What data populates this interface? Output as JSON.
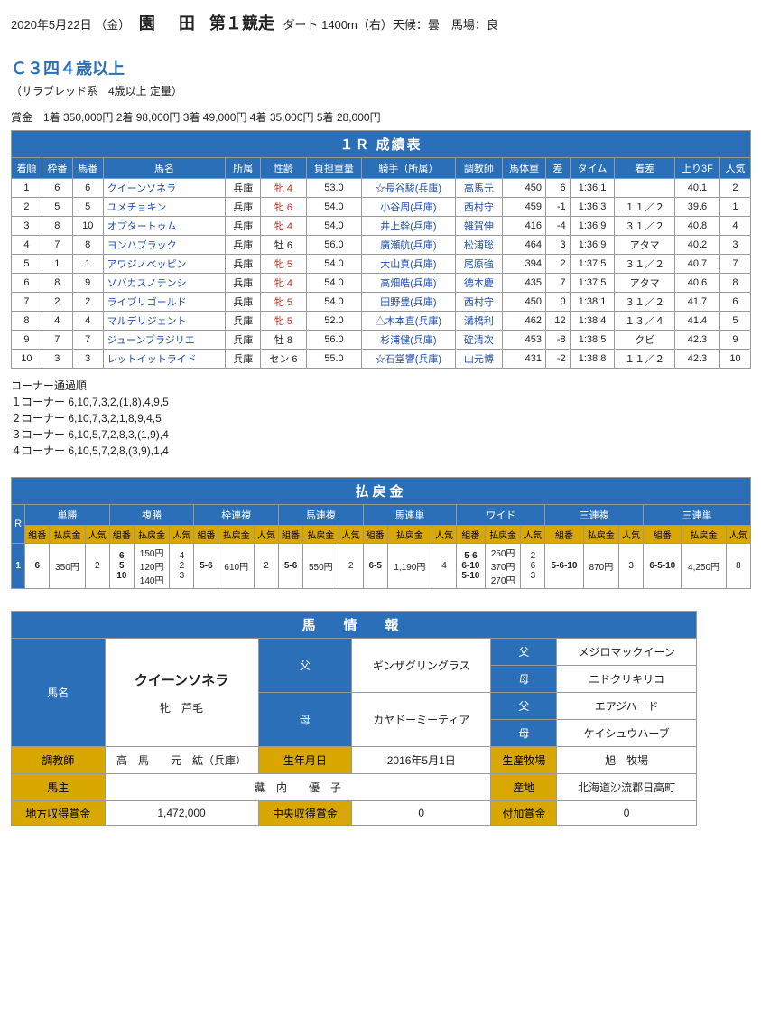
{
  "header": {
    "date": "2020年5月22日 （金）",
    "venue": "園　田",
    "race_no": "第１競走",
    "cond": "ダート 1400m（右）天候：曇　馬場：良"
  },
  "race": {
    "title": "Ｃ３四４歳以上",
    "sub": "（サラブレッド系　4歳以上 定量）",
    "prize": "賞金　1着 350,000円  2着 98,000円  3着 49,000円  4着 35,000円  5着 28,000円"
  },
  "results": {
    "title": "１Ｒ 成績表",
    "cols": [
      "着順",
      "枠番",
      "馬番",
      "馬名",
      "所属",
      "性齢",
      "負担重量",
      "騎手（所属）",
      "調教師",
      "馬体重",
      "差",
      "タイム",
      "着差",
      "上り3F",
      "人気"
    ],
    "rows": [
      {
        "p": "1",
        "w": "6",
        "n": "6",
        "horse": "クイーンソネラ",
        "aff": "兵庫",
        "sa": "牝 4",
        "fem": true,
        "wt": "53.0",
        "jk": "☆長谷駿(兵庫)",
        "tr": "高馬元",
        "bw": "450",
        "d": "6",
        "time": "1:36:1",
        "mg": "",
        "f3": "40.1",
        "pop": "2"
      },
      {
        "p": "2",
        "w": "5",
        "n": "5",
        "horse": "ユメチョキン",
        "aff": "兵庫",
        "sa": "牝 6",
        "fem": true,
        "wt": "54.0",
        "jk": "小谷周(兵庫)",
        "tr": "西村守",
        "bw": "459",
        "d": "-1",
        "time": "1:36:3",
        "mg": "１１／２",
        "f3": "39.6",
        "pop": "1"
      },
      {
        "p": "3",
        "w": "8",
        "n": "10",
        "horse": "オプタートゥム",
        "aff": "兵庫",
        "sa": "牝 4",
        "fem": true,
        "wt": "54.0",
        "jk": "井上幹(兵庫)",
        "tr": "雑賀伸",
        "bw": "416",
        "d": "-4",
        "time": "1:36:9",
        "mg": "３１／２",
        "f3": "40.8",
        "pop": "4"
      },
      {
        "p": "4",
        "w": "7",
        "n": "8",
        "horse": "ヨンハブラック",
        "aff": "兵庫",
        "sa": "牡 6",
        "fem": false,
        "wt": "56.0",
        "jk": "廣瀬航(兵庫)",
        "tr": "松浦聡",
        "bw": "464",
        "d": "3",
        "time": "1:36:9",
        "mg": "アタマ",
        "f3": "40.2",
        "pop": "3"
      },
      {
        "p": "5",
        "w": "1",
        "n": "1",
        "horse": "アワジノべッピン",
        "aff": "兵庫",
        "sa": "牝 5",
        "fem": true,
        "wt": "54.0",
        "jk": "大山真(兵庫)",
        "tr": "尾原強",
        "bw": "394",
        "d": "2",
        "time": "1:37:5",
        "mg": "３１／２",
        "f3": "40.7",
        "pop": "7"
      },
      {
        "p": "6",
        "w": "8",
        "n": "9",
        "horse": "ソバカスノテンシ",
        "aff": "兵庫",
        "sa": "牝 4",
        "fem": true,
        "wt": "54.0",
        "jk": "高畑皓(兵庫)",
        "tr": "德本慶",
        "bw": "435",
        "d": "7",
        "time": "1:37:5",
        "mg": "アタマ",
        "f3": "40.6",
        "pop": "8"
      },
      {
        "p": "7",
        "w": "2",
        "n": "2",
        "horse": "ライブリゴールド",
        "aff": "兵庫",
        "sa": "牝 5",
        "fem": true,
        "wt": "54.0",
        "jk": "田野豊(兵庫)",
        "tr": "西村守",
        "bw": "450",
        "d": "0",
        "time": "1:38:1",
        "mg": "３１／２",
        "f3": "41.7",
        "pop": "6"
      },
      {
        "p": "8",
        "w": "4",
        "n": "4",
        "horse": "マルデリジェント",
        "aff": "兵庫",
        "sa": "牝 5",
        "fem": true,
        "wt": "52.0",
        "jk": "△木本直(兵庫)",
        "tr": "溝橋利",
        "bw": "462",
        "d": "12",
        "time": "1:38:4",
        "mg": "１３／４",
        "f3": "41.4",
        "pop": "5"
      },
      {
        "p": "9",
        "w": "7",
        "n": "7",
        "horse": "ジューンブラジリエ",
        "aff": "兵庫",
        "sa": "牡 8",
        "fem": false,
        "wt": "56.0",
        "jk": "杉浦健(兵庫)",
        "tr": "碇清次",
        "bw": "453",
        "d": "-8",
        "time": "1:38:5",
        "mg": "クビ",
        "f3": "42.3",
        "pop": "9"
      },
      {
        "p": "10",
        "w": "3",
        "n": "3",
        "horse": "レットイットライド",
        "aff": "兵庫",
        "sa": "セン 6",
        "fem": false,
        "wt": "55.0",
        "jk": "☆石堂響(兵庫)",
        "tr": "山元博",
        "bw": "431",
        "d": "-2",
        "time": "1:38:8",
        "mg": "１１／２",
        "f3": "42.3",
        "pop": "10"
      }
    ]
  },
  "corners": {
    "h": "コーナー通過順",
    "l1": "１コーナー 6,10,7,3,2,(1,8),4,9,5",
    "l2": "２コーナー 6,10,7,3,2,1,8,9,4,5",
    "l3": "３コーナー 6,10,5,7,2,8,3,(1,9),4",
    "l4": "４コーナー 6,10,5,7,2,8,(3,9),1,4"
  },
  "payout": {
    "title": "払戻金",
    "r_label": "R",
    "groups": [
      "単勝",
      "複勝",
      "枠連複",
      "馬連複",
      "馬連単",
      "ワイド",
      "三連複",
      "三連単"
    ],
    "sub": [
      "組番",
      "払戻金",
      "人気"
    ],
    "race": "1",
    "tansho": {
      "n": "6",
      "pay": "350円",
      "pop": "2"
    },
    "fukusho": [
      {
        "n": "6",
        "pay": "150円",
        "pop": "4"
      },
      {
        "n": "5",
        "pay": "120円",
        "pop": "2"
      },
      {
        "n": "10",
        "pay": "140円",
        "pop": "3"
      }
    ],
    "wakuren": {
      "n": "5-6",
      "pay": "610円",
      "pop": "2"
    },
    "umaren": {
      "n": "5-6",
      "pay": "550円",
      "pop": "2"
    },
    "umatan": {
      "n": "6-5",
      "pay": "1,190円",
      "pop": "4"
    },
    "wide": [
      {
        "n": "5-6",
        "pay": "250円",
        "pop": "2"
      },
      {
        "n": "6-10",
        "pay": "370円",
        "pop": "6"
      },
      {
        "n": "5-10",
        "pay": "270円",
        "pop": "3"
      }
    ],
    "sanpuku": {
      "n": "5-6-10",
      "pay": "870円",
      "pop": "3"
    },
    "santan": {
      "n": "6-5-10",
      "pay": "4,250円",
      "pop": "8"
    }
  },
  "info": {
    "title": "馬　情　報",
    "lbl_name": "馬名",
    "name": "クイーンソネラ",
    "desc": "牝　芦毛",
    "lbl_sire": "父",
    "lbl_dam": "母",
    "sire": "ギンザグリングラス",
    "dam": "カヤドーミーティア",
    "ss": "メジロマックイーン",
    "sd": "ニドクリキリコ",
    "ds": "エアジハード",
    "dd": "ケイシュウハーブ",
    "lbl_trainer": "調教師",
    "trainer": "高　馬　　元　紘（兵庫）",
    "lbl_birth": "生年月日",
    "birth": "2016年5月1日",
    "lbl_farm": "生産牧場",
    "farm": "旭　牧場",
    "lbl_owner": "馬主",
    "owner": "藏　内　　優　子",
    "lbl_origin": "産地",
    "origin": "北海道沙流郡日高町",
    "lbl_local": "地方収得賞金",
    "local": "1,472,000",
    "lbl_jra": "中央収得賞金",
    "jra": "0",
    "lbl_add": "付加賞金",
    "add": "0"
  }
}
